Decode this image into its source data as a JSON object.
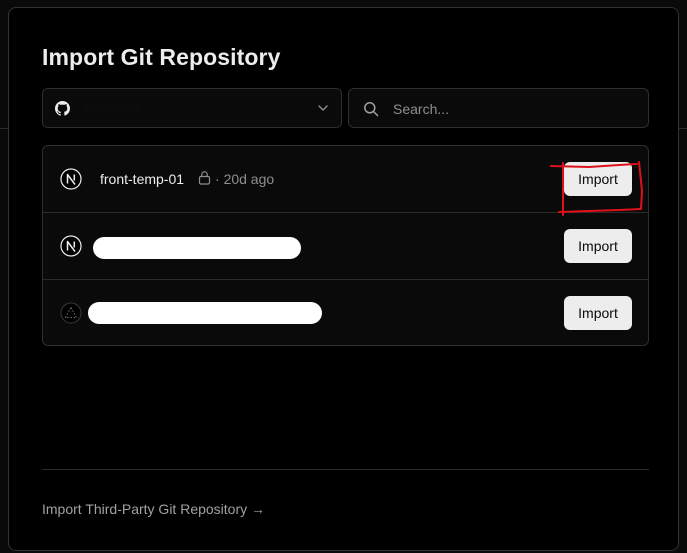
{
  "modal": {
    "title": "Import Git Repository",
    "account_select": {
      "icon": "github-icon",
      "selected_account": ""
    },
    "search": {
      "placeholder": "Search...",
      "value": ""
    },
    "repositories": [
      {
        "icon": "nextjs-icon",
        "name": "front-temp-01",
        "private": true,
        "separator": "·",
        "updated": "20d ago",
        "import_label": "Import"
      },
      {
        "icon": "nextjs-icon",
        "name": "",
        "private": false,
        "updated": "",
        "import_label": "Import"
      },
      {
        "icon": "triangle-icon",
        "name": "",
        "private": false,
        "updated": "",
        "import_label": "Import"
      }
    ],
    "third_party_link": "Import Third-Party Git Repository →"
  },
  "colors": {
    "background": "#000000",
    "text": "#ededed",
    "muted_text": "#8f8f8f",
    "button_bg": "#ededed",
    "annotation": "#e0101a"
  }
}
